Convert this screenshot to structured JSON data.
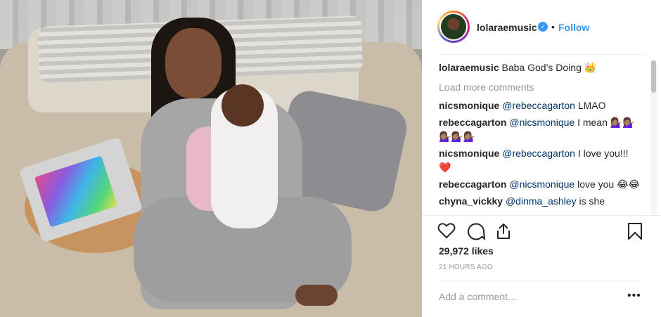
{
  "post": {
    "username": "lolaraemusic",
    "verified_icon": "verified-badge-icon",
    "separator": "•",
    "follow_label": "Follow",
    "caption_user": "lolaraemusic",
    "caption_text": "Baba God’s Doing 👑",
    "load_more": "Load more comments",
    "comments": [
      {
        "user": "nicsmonique",
        "mention": "@rebeccagarton",
        "text": "LMAO"
      },
      {
        "user": "rebeccagarton",
        "mention": "@nicsmonique",
        "text": "I mean 💁🏽‍♀️💁🏽‍♀️💁🏽‍♀️💁🏽‍♀️💁🏽‍♀️"
      },
      {
        "user": "nicsmonique",
        "mention": "@rebeccagarton",
        "text": "I love you!!! ❤️"
      },
      {
        "user": "rebeccagarton",
        "mention": "@nicsmonique",
        "text": "love you 😂😂"
      },
      {
        "user": "chyna_vickky",
        "mention": "@dinma_ashley",
        "text": "is she"
      }
    ],
    "likes": "29,972 likes",
    "time": "21 HOURS AGO",
    "add_comment_placeholder": "Add a comment...",
    "more_label": "•••"
  },
  "icons": [
    "heart-icon",
    "comment-icon",
    "share-icon",
    "bookmark-icon"
  ],
  "colors": {
    "accent": "#3897f0",
    "text": "#262626",
    "muted": "#999999"
  }
}
